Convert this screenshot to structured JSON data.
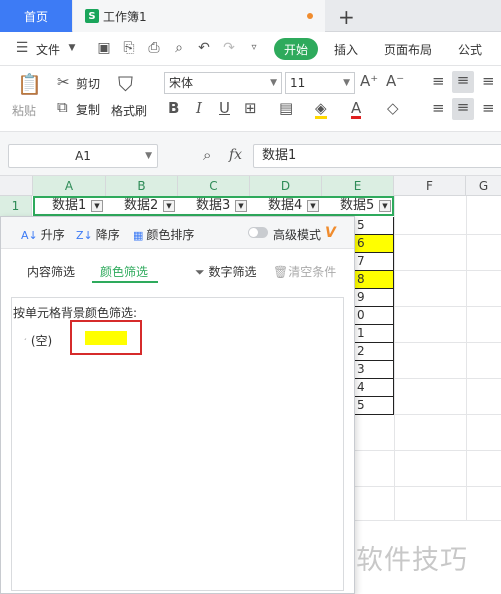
{
  "tabs": {
    "home": "首页",
    "workbook": "工作簿1",
    "new_tab": "+"
  },
  "menu": {
    "file": "文件",
    "start": "开始",
    "insert": "插入",
    "page_layout": "页面布局",
    "formula": "公式"
  },
  "toolbar": {
    "paste": "粘贴",
    "cut": "剪切",
    "copy": "复制",
    "format_painter": "格式刷",
    "font": "宋体",
    "font_size": "11",
    "bold": "B",
    "italic": "I",
    "underline": "U"
  },
  "formula_bar": {
    "cell_ref": "A1",
    "fx": "fx",
    "content": "数据1"
  },
  "columns": [
    "A",
    "B",
    "C",
    "D",
    "E",
    "F",
    "G"
  ],
  "row_number": "1",
  "header_cells": [
    "数据1",
    "数据2",
    "数据3",
    "数据4",
    "数据5"
  ],
  "column_e_values": [
    {
      "text": "5",
      "yellow": false
    },
    {
      "text": "6",
      "yellow": true
    },
    {
      "text": "7",
      "yellow": false
    },
    {
      "text": "8",
      "yellow": true
    },
    {
      "text": "9",
      "yellow": false
    },
    {
      "text": "0",
      "yellow": false
    },
    {
      "text": "1",
      "yellow": false
    },
    {
      "text": "2",
      "yellow": false
    },
    {
      "text": "3",
      "yellow": false
    },
    {
      "text": "4",
      "yellow": false
    },
    {
      "text": "5",
      "yellow": false
    }
  ],
  "filter_panel": {
    "sort_asc": "升序",
    "sort_desc": "降序",
    "color_sort": "颜色排序",
    "advanced_mode": "高级模式",
    "tab_content": "内容筛选",
    "tab_color": "颜色筛选",
    "number_filter": "数字筛选",
    "clear_conditions": "清空条件",
    "description": "按单元格背景颜色筛选:",
    "empty_option": "(空)",
    "swatch_color": "#ffff00"
  },
  "watermark": "软件技巧",
  "colors": {
    "accent_green": "#2eaa5c",
    "home_tab_blue": "#3d7bf5",
    "highlight_red": "#d62b2b"
  }
}
